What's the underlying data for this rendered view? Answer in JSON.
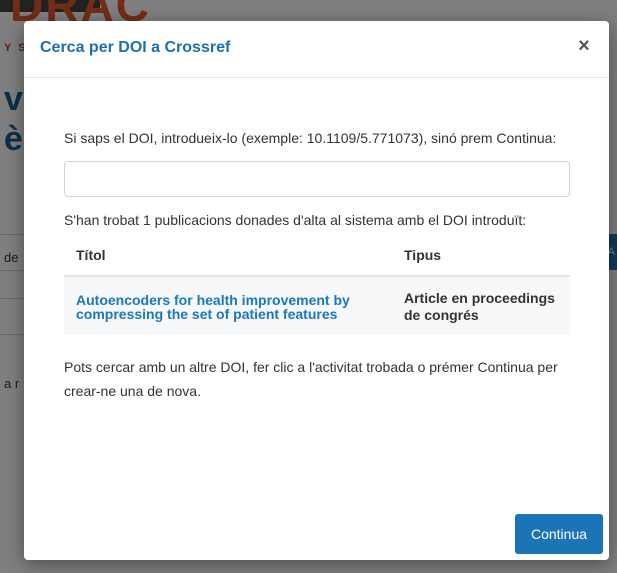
{
  "background": {
    "tag_text": "Y S",
    "title_line1": "vi",
    "title_line2": "è",
    "field_text": "de",
    "text_line": "a r",
    "right_btn_text": "A"
  },
  "modal": {
    "title": "Cerca per DOI a Crossref",
    "close_symbol": "×",
    "instruction": "Si saps el DOI, introdueix-lo (exemple: 10.1109/5.771073), sinó prem Continua:",
    "doi_input": {
      "value": "",
      "placeholder": ""
    },
    "found_message": "S'han trobat 1 publicacions donades d'alta al sistema amb el DOI introduït:",
    "table": {
      "headers": [
        "Títol",
        "Tipus"
      ],
      "rows": [
        {
          "title": "Autoencoders for health improvement by compressing the set of patient features",
          "type": "Article en proceedings de congrés"
        }
      ]
    },
    "help_text": "Pots cercar amb un altre DOI, fer clic a l'activitat trobada o prémer Continua per crear-ne una de nova.",
    "continue_label": "Continua"
  },
  "colors": {
    "accent": "#1a74b5",
    "title": "#1f6fb0",
    "logo": "#e25b2c"
  }
}
